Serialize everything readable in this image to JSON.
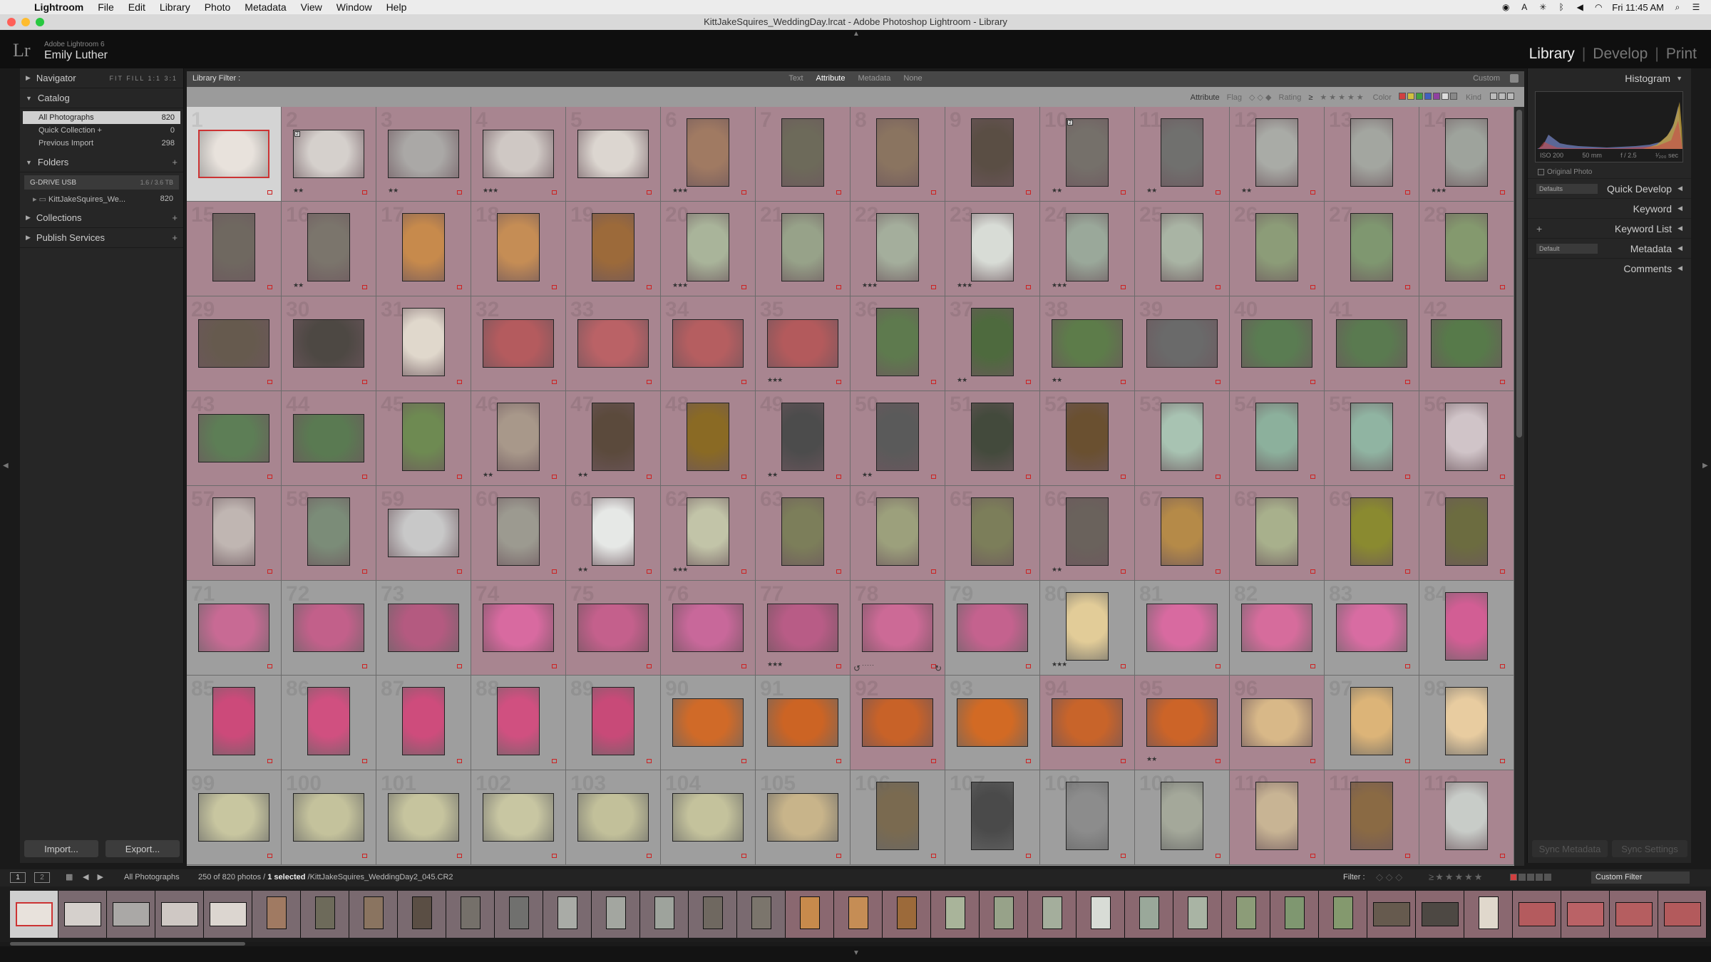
{
  "menubar": {
    "app": "Lightroom",
    "items": [
      "File",
      "Edit",
      "Library",
      "Photo",
      "Metadata",
      "View",
      "Window",
      "Help"
    ],
    "clock": "Fri 11:45 AM"
  },
  "window": {
    "title": "KittJakeSquires_WeddingDay.lrcat - Adobe Photoshop Lightroom - Library"
  },
  "identity": {
    "logo": "Lr",
    "product": "Adobe Lightroom 6",
    "user": "Emily Luther",
    "modules": [
      "Library",
      "Develop",
      "Print"
    ],
    "active_module": "Library"
  },
  "left_panel": {
    "navigator": {
      "title": "Navigator",
      "options": "FIT  FILL  1:1  3:1"
    },
    "catalog": {
      "title": "Catalog",
      "items": [
        {
          "label": "All Photographs",
          "count": "820"
        },
        {
          "label": "Quick Collection +",
          "count": "0"
        },
        {
          "label": "Previous Import",
          "count": "298"
        }
      ]
    },
    "folders": {
      "title": "Folders",
      "volume": {
        "label": "G-DRIVE USB",
        "space": "1.6 / 3.6 TB"
      },
      "folder": {
        "label": "KittJakeSquires_We...",
        "count": "820"
      }
    },
    "collections": {
      "title": "Collections"
    },
    "publish": {
      "title": "Publish Services"
    },
    "import_label": "Import...",
    "export_label": "Export..."
  },
  "filter_bar": {
    "label": "Library Filter :",
    "tabs": [
      "Text",
      "Attribute",
      "Metadata",
      "None"
    ],
    "active_tab": "Attribute",
    "preset": "Custom",
    "attr": {
      "title": "Attribute",
      "flag": "Flag",
      "rating": "Rating",
      "rating_op": "≥",
      "color": "Color",
      "kind": "Kind"
    }
  },
  "right_panel": {
    "histogram": {
      "title": "Histogram",
      "iso": "ISO 200",
      "focal": "50 mm",
      "aperture": "f / 2.5",
      "shutter": "¹⁄₂₀₀ sec"
    },
    "original_photo": "Original Photo",
    "rows": [
      {
        "preset": "Defaults",
        "title": "Quick Develop"
      },
      {
        "preset": "",
        "title": "Keyword"
      },
      {
        "preset": "",
        "title": "Keyword List",
        "plus": true
      },
      {
        "preset": "Default",
        "title": "Metadata"
      },
      {
        "preset": "",
        "title": "Comments"
      }
    ],
    "sync_metadata": "Sync Metadata",
    "sync_settings": "Sync Settings"
  },
  "filmstrip_bar": {
    "page1": "1",
    "page2": "2",
    "source": "All Photographs",
    "count": "250 of 820 photos /",
    "selected": "1 selected",
    "path": "/KittJakeSquires_WeddingDay2_045.CR2",
    "filter_label": "Filter :",
    "custom_filter": "Custom Filter"
  },
  "grid": {
    "columns": 14,
    "rows": [
      {
        "bg": "#a88590",
        "cells": [
          {
            "n": "1",
            "stars": "",
            "tone": "#e8e2dc",
            "sel": true
          },
          {
            "n": "2",
            "stars": "★★",
            "tone": "#d5d0cc",
            "badge": "2"
          },
          {
            "n": "3",
            "stars": "★★",
            "tone": "#aaa8a6"
          },
          {
            "n": "4",
            "stars": "★★★",
            "tone": "#cfc8c4"
          },
          {
            "n": "5",
            "stars": "",
            "tone": "#dcd6d0"
          },
          {
            "n": "6",
            "stars": "★★★",
            "tone": "#a07a62",
            "portrait": true
          },
          {
            "n": "7",
            "stars": "",
            "tone": "#6d6a5a",
            "portrait": true
          },
          {
            "n": "8",
            "stars": "",
            "tone": "#8a7460",
            "portrait": true
          },
          {
            "n": "9",
            "stars": "",
            "tone": "#5a4e44",
            "portrait": true
          },
          {
            "n": "10",
            "stars": "★★",
            "tone": "#75706a",
            "portrait": true,
            "badge": "2"
          },
          {
            "n": "11",
            "stars": "★★",
            "tone": "#70706e",
            "portrait": true
          },
          {
            "n": "12",
            "stars": "★★",
            "tone": "#a9aba6",
            "portrait": true
          },
          {
            "n": "13",
            "stars": "",
            "tone": "#a3a6a0",
            "portrait": true
          },
          {
            "n": "14",
            "stars": "★★★",
            "tone": "#9ea39c",
            "portrait": true
          }
        ]
      },
      {
        "bg": "#a88590",
        "cells": [
          {
            "n": "15",
            "stars": "",
            "tone": "#6f6860",
            "portrait": true
          },
          {
            "n": "16",
            "stars": "★★",
            "tone": "#7b756c",
            "portrait": true
          },
          {
            "n": "17",
            "stars": "",
            "tone": "#c78a4c",
            "portrait": true
          },
          {
            "n": "18",
            "stars": "",
            "tone": "#c58d55",
            "portrait": true
          },
          {
            "n": "19",
            "stars": "",
            "tone": "#9c6a3a",
            "portrait": true
          },
          {
            "n": "20",
            "stars": "★★★",
            "tone": "#a9b49a",
            "portrait": true
          },
          {
            "n": "21",
            "stars": "",
            "tone": "#97a289",
            "portrait": true
          },
          {
            "n": "22",
            "stars": "★★★",
            "tone": "#a4ae9c",
            "portrait": true
          },
          {
            "n": "23",
            "stars": "★★★",
            "tone": "#d8dcd6",
            "portrait": true
          },
          {
            "n": "24",
            "stars": "★★★",
            "tone": "#9aa89a",
            "portrait": true
          },
          {
            "n": "25",
            "stars": "",
            "tone": "#a9b4a4",
            "portrait": true
          },
          {
            "n": "26",
            "stars": "",
            "tone": "#8c9c78",
            "portrait": true
          },
          {
            "n": "27",
            "stars": "",
            "tone": "#7f9770",
            "portrait": true
          },
          {
            "n": "28",
            "stars": "",
            "tone": "#84996e",
            "portrait": true
          }
        ]
      },
      {
        "bg": "#a88590",
        "cells": [
          {
            "n": "29",
            "stars": "",
            "tone": "#665a4e"
          },
          {
            "n": "30",
            "stars": "",
            "tone": "#4d4843"
          },
          {
            "n": "31",
            "stars": "",
            "tone": "#e0d8cc",
            "portrait": true
          },
          {
            "n": "32",
            "stars": "",
            "tone": "#b45b5e"
          },
          {
            "n": "33",
            "stars": "",
            "tone": "#ba6266"
          },
          {
            "n": "34",
            "stars": "",
            "tone": "#b55e60"
          },
          {
            "n": "35",
            "stars": "★★★",
            "tone": "#b35a5c"
          },
          {
            "n": "36",
            "stars": "",
            "tone": "#5e7a4e",
            "portrait": true
          },
          {
            "n": "37",
            "stars": "★★",
            "tone": "#4e6a3e",
            "portrait": true
          },
          {
            "n": "38",
            "stars": "★★",
            "tone": "#5d7c4a"
          },
          {
            "n": "39",
            "stars": "",
            "tone": "#6a6a6a"
          },
          {
            "n": "40",
            "stars": "",
            "tone": "#5a7c52"
          },
          {
            "n": "41",
            "stars": "",
            "tone": "#5a7a50"
          },
          {
            "n": "42",
            "stars": "",
            "tone": "#577a4a"
          }
        ]
      },
      {
        "bg": "#a88590",
        "cells": [
          {
            "n": "43",
            "stars": "",
            "tone": "#5d7e56"
          },
          {
            "n": "44",
            "stars": "",
            "tone": "#5a7a52"
          },
          {
            "n": "45",
            "stars": "",
            "tone": "#6e8a52",
            "portrait": true
          },
          {
            "n": "46",
            "stars": "★★",
            "tone": "#a8988a",
            "portrait": true
          },
          {
            "n": "47",
            "stars": "★★",
            "tone": "#5b4a3c",
            "portrait": true
          },
          {
            "n": "48",
            "stars": "",
            "tone": "#8a6a24",
            "portrait": true
          },
          {
            "n": "49",
            "stars": "★★",
            "tone": "#4c4c4c",
            "portrait": true
          },
          {
            "n": "50",
            "stars": "★★",
            "tone": "#5a5a5a",
            "portrait": true
          },
          {
            "n": "51",
            "stars": "",
            "tone": "#434a3c",
            "portrait": true
          },
          {
            "n": "52",
            "stars": "",
            "tone": "#6a5030",
            "portrait": true
          },
          {
            "n": "53",
            "stars": "",
            "tone": "#a8c3b2",
            "portrait": true
          },
          {
            "n": "54",
            "stars": "",
            "tone": "#8cb09c",
            "portrait": true
          },
          {
            "n": "55",
            "stars": "",
            "tone": "#90b4a2",
            "portrait": true
          },
          {
            "n": "56",
            "stars": "",
            "tone": "#d0c4c8",
            "portrait": true
          }
        ]
      },
      {
        "bg": "#a88590",
        "cells": [
          {
            "n": "57",
            "stars": "",
            "tone": "#c0b6b2",
            "portrait": true
          },
          {
            "n": "58",
            "stars": "",
            "tone": "#7b8c78",
            "portrait": true
          },
          {
            "n": "59",
            "stars": "",
            "tone": "#c8c8c8"
          },
          {
            "n": "60",
            "stars": "",
            "tone": "#9c9a90",
            "portrait": true
          },
          {
            "n": "61",
            "stars": "★★",
            "tone": "#e6e8e6",
            "portrait": true
          },
          {
            "n": "62",
            "stars": "★★★",
            "tone": "#c2c4a8",
            "portrait": true
          },
          {
            "n": "63",
            "stars": "",
            "tone": "#7c7e5a",
            "portrait": true
          },
          {
            "n": "64",
            "stars": "",
            "tone": "#9ca07c",
            "portrait": true
          },
          {
            "n": "65",
            "stars": "",
            "tone": "#7c7e5a",
            "portrait": true
          },
          {
            "n": "66",
            "stars": "★★",
            "tone": "#6a625c",
            "portrait": true
          },
          {
            "n": "67",
            "stars": "",
            "tone": "#b58a48",
            "portrait": true
          },
          {
            "n": "68",
            "stars": "",
            "tone": "#a8b08c",
            "portrait": true
          },
          {
            "n": "69",
            "stars": "",
            "tone": "#8a8a30",
            "portrait": true
          },
          {
            "n": "70",
            "stars": "",
            "tone": "#6c6c40",
            "portrait": true
          }
        ]
      },
      {
        "bg": "#9e9e9e",
        "cells": [
          {
            "n": "71",
            "stars": "",
            "tone": "#c86a94"
          },
          {
            "n": "72",
            "stars": "",
            "tone": "#c2608a"
          },
          {
            "n": "73",
            "stars": "",
            "tone": "#b45a80"
          },
          {
            "n": "74",
            "stars": "",
            "tone": "#d86aa0",
            "pink": true
          },
          {
            "n": "75",
            "stars": "",
            "tone": "#c4608c",
            "pink": true
          },
          {
            "n": "76",
            "stars": "",
            "tone": "#c8689a",
            "pink": true
          },
          {
            "n": "77",
            "stars": "★★★",
            "tone": "#b85c86",
            "pink": true
          },
          {
            "n": "78",
            "stars": "· · · · ·",
            "tone": "#cc6a96",
            "pink": true,
            "hover": true
          },
          {
            "n": "79",
            "stars": "",
            "tone": "#c4628e"
          },
          {
            "n": "80",
            "stars": "★★★",
            "tone": "#e2cc98",
            "portrait": true
          },
          {
            "n": "81",
            "stars": "",
            "tone": "#d86aa0"
          },
          {
            "n": "82",
            "stars": "",
            "tone": "#d66c9c"
          },
          {
            "n": "83",
            "stars": "",
            "tone": "#d86ca2"
          },
          {
            "n": "84",
            "stars": "",
            "tone": "#d25e94",
            "portrait": true
          }
        ]
      },
      {
        "bg": "#9e9e9e",
        "cells": [
          {
            "n": "85",
            "stars": "",
            "tone": "#cc4a7a",
            "portrait": true
          },
          {
            "n": "86",
            "stars": "",
            "tone": "#d05080",
            "portrait": true
          },
          {
            "n": "87",
            "stars": "",
            "tone": "#ce4c7c",
            "portrait": true
          },
          {
            "n": "88",
            "stars": "",
            "tone": "#d05080",
            "portrait": true
          },
          {
            "n": "89",
            "stars": "",
            "tone": "#c84a78",
            "portrait": true
          },
          {
            "n": "90",
            "stars": "",
            "tone": "#d06a28"
          },
          {
            "n": "91",
            "stars": "",
            "tone": "#cc6424"
          },
          {
            "n": "92",
            "stars": "",
            "tone": "#c86228",
            "pink": true
          },
          {
            "n": "93",
            "stars": "",
            "tone": "#d26a24"
          },
          {
            "n": "94",
            "stars": "",
            "tone": "#c8642a",
            "pink": true
          },
          {
            "n": "95",
            "stars": "★★",
            "tone": "#cc6428",
            "pink": true
          },
          {
            "n": "96",
            "stars": "",
            "tone": "#d8b888",
            "pink": true
          },
          {
            "n": "97",
            "stars": "",
            "tone": "#dcb478",
            "portrait": true
          },
          {
            "n": "98",
            "stars": "",
            "tone": "#e8cca0",
            "portrait": true
          }
        ]
      },
      {
        "bg": "#9e9e9e",
        "cells": [
          {
            "n": "99",
            "stars": "",
            "tone": "#c8c6a0"
          },
          {
            "n": "100",
            "stars": "",
            "tone": "#c4c29c"
          },
          {
            "n": "101",
            "stars": "",
            "tone": "#c6c49e"
          },
          {
            "n": "102",
            "stars": "",
            "tone": "#c8c6a2"
          },
          {
            "n": "103",
            "stars": "",
            "tone": "#c2c09a"
          },
          {
            "n": "104",
            "stars": "",
            "tone": "#c4c29c"
          },
          {
            "n": "105",
            "stars": "",
            "tone": "#c8b48a"
          },
          {
            "n": "106",
            "stars": "",
            "tone": "#7a6a50",
            "portrait": true
          },
          {
            "n": "107",
            "stars": "",
            "tone": "#4a4a4a",
            "portrait": true
          },
          {
            "n": "108",
            "stars": "",
            "tone": "#8c8c8c",
            "portrait": true
          },
          {
            "n": "109",
            "stars": "",
            "tone": "#a4a89a",
            "portrait": true
          },
          {
            "n": "110",
            "stars": "",
            "tone": "#c8b494",
            "portrait": true,
            "pink": true
          },
          {
            "n": "111",
            "stars": "",
            "tone": "#8a6a44",
            "portrait": true,
            "pink": true
          },
          {
            "n": "112",
            "stars": "",
            "tone": "#c8ccc8",
            "portrait": true,
            "pink": true
          }
        ]
      }
    ]
  },
  "filmstrip": {
    "tones": [
      "#e8e2dc",
      "#d5d0cc",
      "#aaa8a6",
      "#cfc8c4",
      "#dcd6d0",
      "#a07a62",
      "#6d6a5a",
      "#8a7460",
      "#5a4e44",
      "#75706a",
      "#70706e",
      "#a9aba6",
      "#a3a6a0",
      "#9ea39c",
      "#6f6860",
      "#7b756c",
      "#c78a4c",
      "#c58d55",
      "#9c6a3a",
      "#a9b49a",
      "#97a289",
      "#a4ae9c",
      "#d8dcd6",
      "#9aa89a",
      "#a9b4a4",
      "#8c9c78",
      "#7f9770",
      "#84996e",
      "#665a4e",
      "#4d4843",
      "#e0d8cc",
      "#b45b5e",
      "#ba6266",
      "#b55e60",
      "#b35a5c"
    ]
  }
}
